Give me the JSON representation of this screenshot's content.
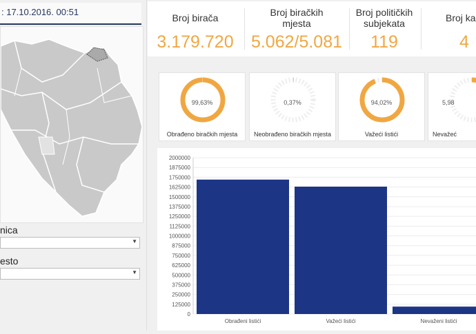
{
  "header": {
    "timestamp_text": ": 17.10.2016. 00:51"
  },
  "filters": {
    "first_label": "nica",
    "second_label": "esto"
  },
  "stats": [
    {
      "label": "Broj birača",
      "value": "3.179.720"
    },
    {
      "label": "Broj biračkih mjesta",
      "value": "5.062/5.081"
    },
    {
      "label": "Broj političkih subjekata",
      "value": "119"
    },
    {
      "label": "Broj ka",
      "value": "4"
    }
  ],
  "donuts": [
    {
      "percent": "99,63%",
      "label": "Obrađeno biračkih mjesta",
      "fraction": 0.9963
    },
    {
      "percent": "0,37%",
      "label": "Neobrađeno biračkih mjesta",
      "fraction": 0.0037
    },
    {
      "percent": "94,02%",
      "label": "Važeći listići",
      "fraction": 0.9402
    },
    {
      "percent": "5,98",
      "label": "Nevažeć",
      "fraction": 0.0598
    }
  ],
  "colors": {
    "accent": "#f0a742",
    "bar": "#1c3585",
    "navy": "#25365f"
  },
  "chart_data": {
    "type": "bar",
    "categories": [
      "Obrađeni listići",
      "Važeći listići",
      "Nevaženi listići"
    ],
    "values": [
      1720000,
      1630000,
      95000
    ],
    "ylim": [
      0,
      2000000
    ],
    "yticks": [
      0,
      125000,
      250000,
      375000,
      500000,
      625000,
      750000,
      875000,
      1000000,
      1125000,
      1250000,
      1375000,
      1500000,
      1625000,
      1750000,
      1875000,
      2000000
    ],
    "title": "",
    "xlabel": "",
    "ylabel": "",
    "grid": true
  }
}
